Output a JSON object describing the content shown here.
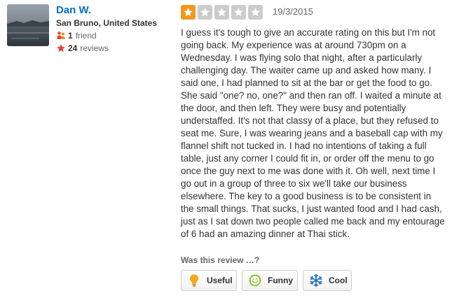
{
  "user": {
    "name": "Dan W.",
    "location": "San Bruno, United States",
    "friends_count": "1",
    "friends_label": "friend",
    "reviews_count": "24",
    "reviews_label": "reviews",
    "avatar_icon": "user-photo-water-landscape"
  },
  "review": {
    "rating": 1,
    "rating_max": 5,
    "date": "19/3/2015",
    "text": "I guess it's tough to give an accurate rating on this but I'm not going back. My experience was at around 730pm on a Wednesday. I was flying solo that night, after a particularly challenging day. The waiter came up and asked how many. I said one, I had planned to sit at the bar or get the food to go. She said \"one? no, one?\" and then ran off. I waited a minute at the door, and then left. They were busy and potentially understaffed. It's not that classy of a place, but they refused to seat me. Sure, I was wearing jeans and a baseball cap with my flannel shift not tucked in. I had no intentions of taking a full table, just any corner I could fit in, or order off the menu to go once the guy next to me was done with it. Oh well, next time I go out in a group of three to six we'll take our business elsewhere. The key to a good business is to be consistent in the small things. That sucks, I just wanted food and I had cash, just as I sat down two people called me back and my entourage of 6 had an amazing dinner at Thai stick."
  },
  "feedback": {
    "prompt": "Was this review …?",
    "buttons": {
      "useful": "Useful",
      "funny": "Funny",
      "cool": "Cool"
    }
  },
  "colors": {
    "star_filled": "#f0991e",
    "star_empty": "#cccccc",
    "link": "#0073bb",
    "review_star_icon": "#e8422e"
  }
}
